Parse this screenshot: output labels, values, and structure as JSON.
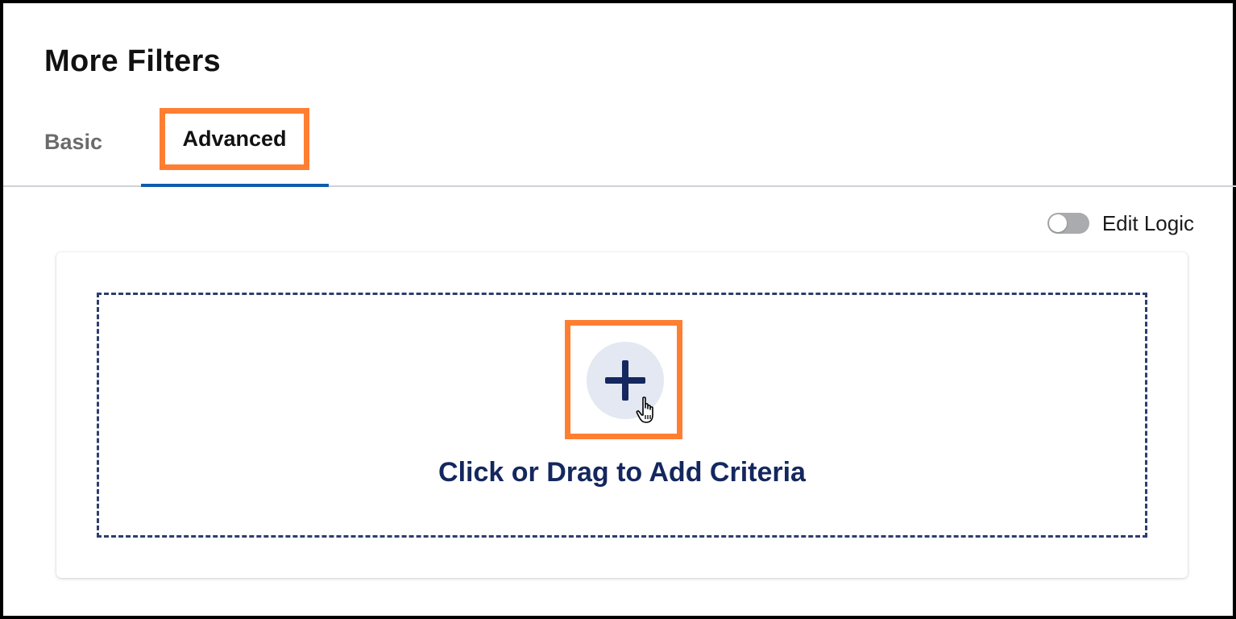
{
  "header": {
    "title": "More Filters"
  },
  "tabs": [
    {
      "label": "Basic",
      "active": false
    },
    {
      "label": "Advanced",
      "active": true
    }
  ],
  "edit_logic": {
    "label": "Edit Logic",
    "enabled": false
  },
  "criteria": {
    "add_label": "Click or Drag to Add Criteria",
    "add_icon": "plus-icon"
  },
  "colors": {
    "accent": "#0b5cad",
    "highlight": "#ff7f32",
    "primary_text": "#14275e",
    "add_button_bg": "#e3e8f2"
  }
}
